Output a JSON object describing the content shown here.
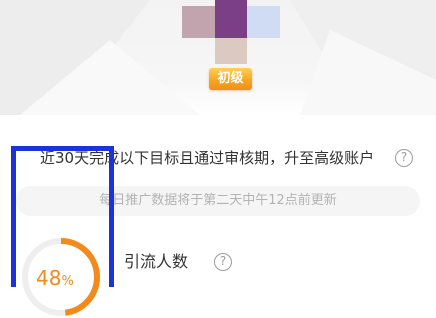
{
  "level": {
    "badge_label": "初级"
  },
  "goal": {
    "text": "近30天完成以下目标且通过审核期，升至高级账户"
  },
  "notice": {
    "text": "每日推广数据将于第二天中午12点前更新"
  },
  "metric": {
    "label": "引流人数",
    "percent_value": "48",
    "percent_unit": "%",
    "progress": 0.48
  },
  "icons": {
    "help": "help-question-icon",
    "help_glyph": "?"
  },
  "colors": {
    "accent": "#f28a1c",
    "highlight": "#1a34d8",
    "badge": "#f6a623"
  }
}
